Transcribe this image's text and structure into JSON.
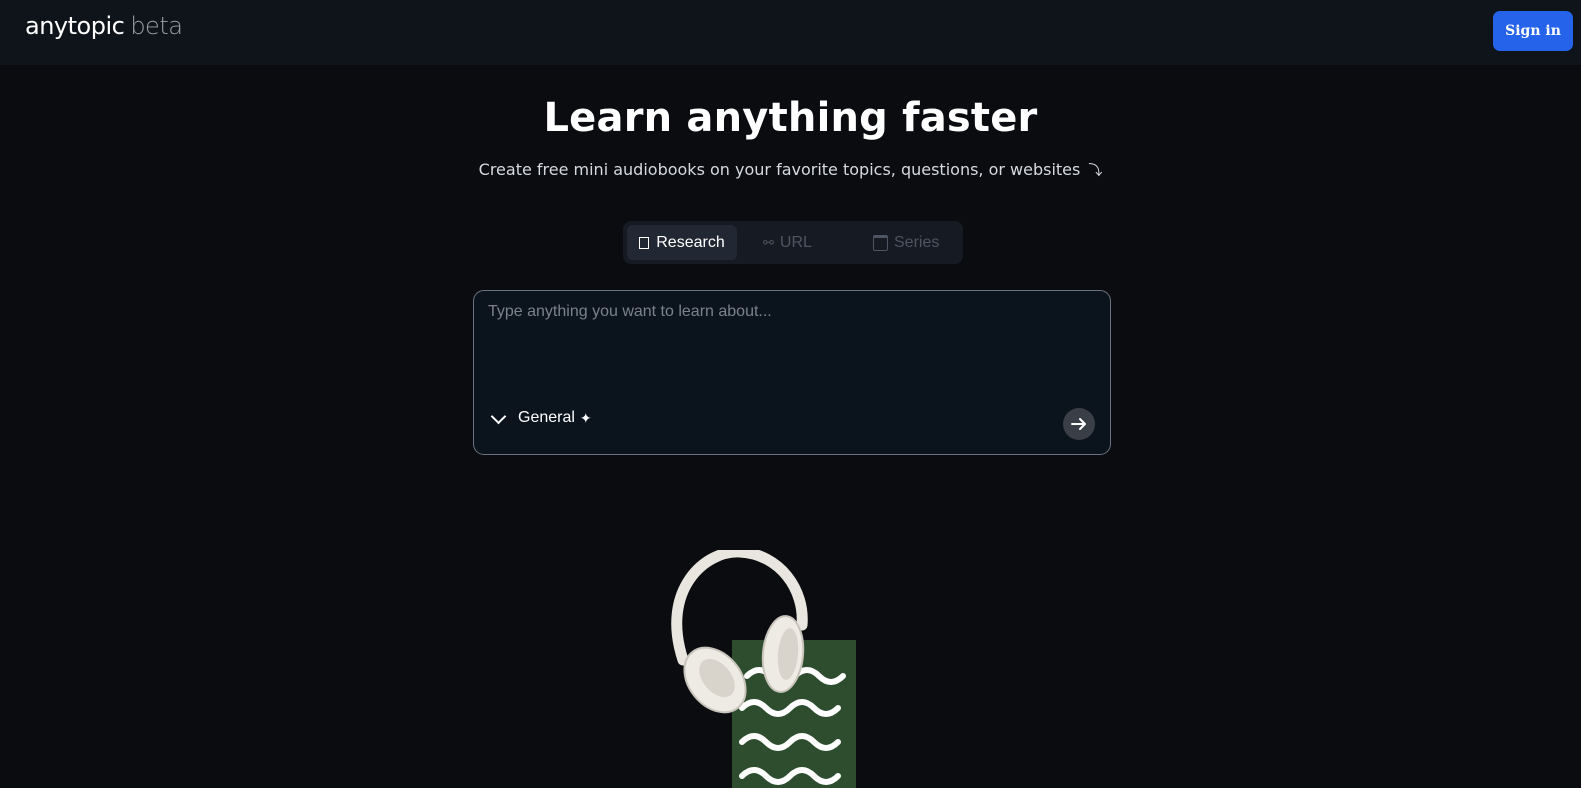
{
  "header": {
    "logo_main": "anytopic",
    "logo_suffix": "beta",
    "signin_label": "Sign in"
  },
  "hero": {
    "title": "Learn anything faster",
    "subtitle": "Create free mini audiobooks on your favorite topics, questions, or websites",
    "subtitle_arrow": "⤵"
  },
  "tabs": [
    {
      "label": "Research",
      "active": true,
      "icon": "document-icon"
    },
    {
      "label": "URL",
      "active": false,
      "icon": "link-icon"
    },
    {
      "label": "Series",
      "active": false,
      "icon": "calendar-icon"
    }
  ],
  "input": {
    "placeholder": "Type anything you want to learn about...",
    "value": "",
    "mode_label": "General",
    "mode_icon": "sparkles-icon",
    "send_icon": "arrow-right-icon"
  },
  "colors": {
    "background": "#0a0c10",
    "topbar": "#0f141b",
    "accent": "#2563eb",
    "book_green": "#2e4d2e"
  }
}
